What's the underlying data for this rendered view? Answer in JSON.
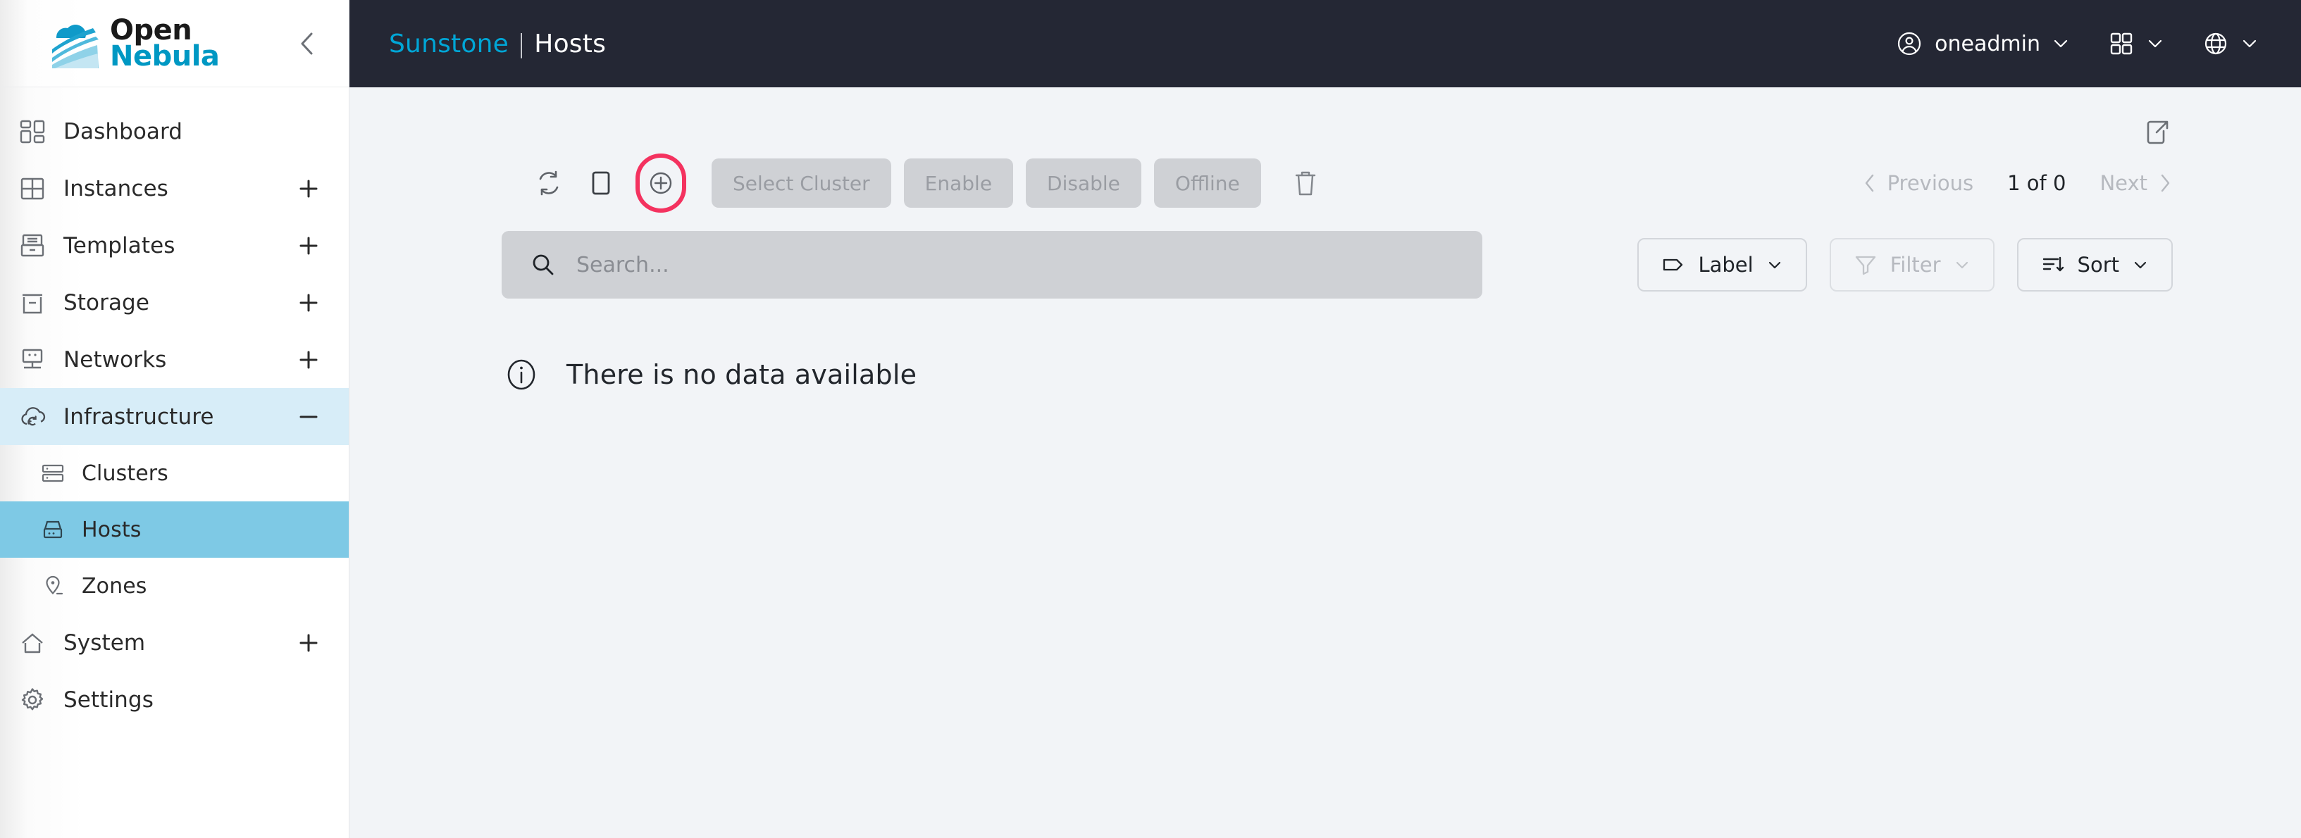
{
  "brand": {
    "name_line1": "Open",
    "name_line2": "Nebula",
    "logo_icon": "opennebula-cloud-logo",
    "collapse_icon": "chevron-left-icon",
    "colors": {
      "cyan": "#0098c3",
      "dark": "#1a1a1a"
    }
  },
  "sidebar": {
    "items": [
      {
        "label": "Dashboard",
        "icon": "dashboard-grid-icon",
        "adorn": "none",
        "state": "normal",
        "level": "top"
      },
      {
        "label": "Instances",
        "icon": "instances-grid-icon",
        "adorn": "plus",
        "state": "normal",
        "level": "top"
      },
      {
        "label": "Templates",
        "icon": "templates-box-icon",
        "adorn": "plus",
        "state": "normal",
        "level": "top"
      },
      {
        "label": "Storage",
        "icon": "storage-drive-icon",
        "adorn": "plus",
        "state": "normal",
        "level": "top"
      },
      {
        "label": "Networks",
        "icon": "network-node-icon",
        "adorn": "plus",
        "state": "normal",
        "level": "top"
      },
      {
        "label": "Infrastructure",
        "icon": "cloud-sync-icon",
        "adorn": "minus",
        "state": "expanded",
        "level": "top"
      },
      {
        "label": "Clusters",
        "icon": "clusters-servers-icon",
        "adorn": "none",
        "state": "normal",
        "level": "sub"
      },
      {
        "label": "Hosts",
        "icon": "host-server-icon",
        "adorn": "none",
        "state": "selected",
        "level": "sub"
      },
      {
        "label": "Zones",
        "icon": "zone-pin-icon",
        "adorn": "none",
        "state": "normal",
        "level": "sub"
      },
      {
        "label": "System",
        "icon": "home-icon",
        "adorn": "plus",
        "state": "normal",
        "level": "top"
      },
      {
        "label": "Settings",
        "icon": "gear-icon",
        "adorn": "none",
        "state": "normal",
        "level": "top"
      }
    ],
    "active_color": "#7ec9e5",
    "active_parent_color": "#d7edf8"
  },
  "topbar": {
    "product": "Sunstone",
    "separator": "|",
    "section": "Hosts",
    "background": "#242734",
    "user": {
      "name": "oneadmin",
      "icon": "user-circle-icon",
      "chevron": "chevron-down-icon"
    },
    "apps": {
      "icon": "apps-grid-icon",
      "chevron": "chevron-down-icon"
    },
    "language": {
      "icon": "globe-icon",
      "chevron": "chevron-down-icon"
    }
  },
  "content": {
    "external_link_icon": "external-link-icon",
    "toolbar": {
      "refresh_icon": "refresh-icon",
      "select_all_icon": "checkbox-empty-icon",
      "add_icon": "plus-circle-icon",
      "add_highlight_color": "#f4325f",
      "buttons": [
        {
          "label": "Select Cluster",
          "disabled": true
        },
        {
          "label": "Enable",
          "disabled": true
        },
        {
          "label": "Disable",
          "disabled": true
        },
        {
          "label": "Offline",
          "disabled": true
        }
      ],
      "delete_icon": "trash-icon"
    },
    "pagination": {
      "previous_label": "Previous",
      "previous_icon": "chevron-left-icon",
      "count_label": "1 of 0",
      "next_label": "Next",
      "next_icon": "chevron-right-icon"
    },
    "search": {
      "icon": "search-icon",
      "placeholder": "Search...",
      "value": ""
    },
    "filters": [
      {
        "label": "Label",
        "icon": "tag-icon",
        "chevron": "chevron-down-icon",
        "disabled": false
      },
      {
        "label": "Filter",
        "icon": "funnel-icon",
        "chevron": "chevron-down-icon",
        "disabled": true
      },
      {
        "label": "Sort",
        "icon": "sort-icon",
        "chevron": "chevron-down-icon",
        "disabled": false
      }
    ],
    "empty_state": {
      "icon": "info-circle-icon",
      "message": "There is no data available"
    }
  }
}
